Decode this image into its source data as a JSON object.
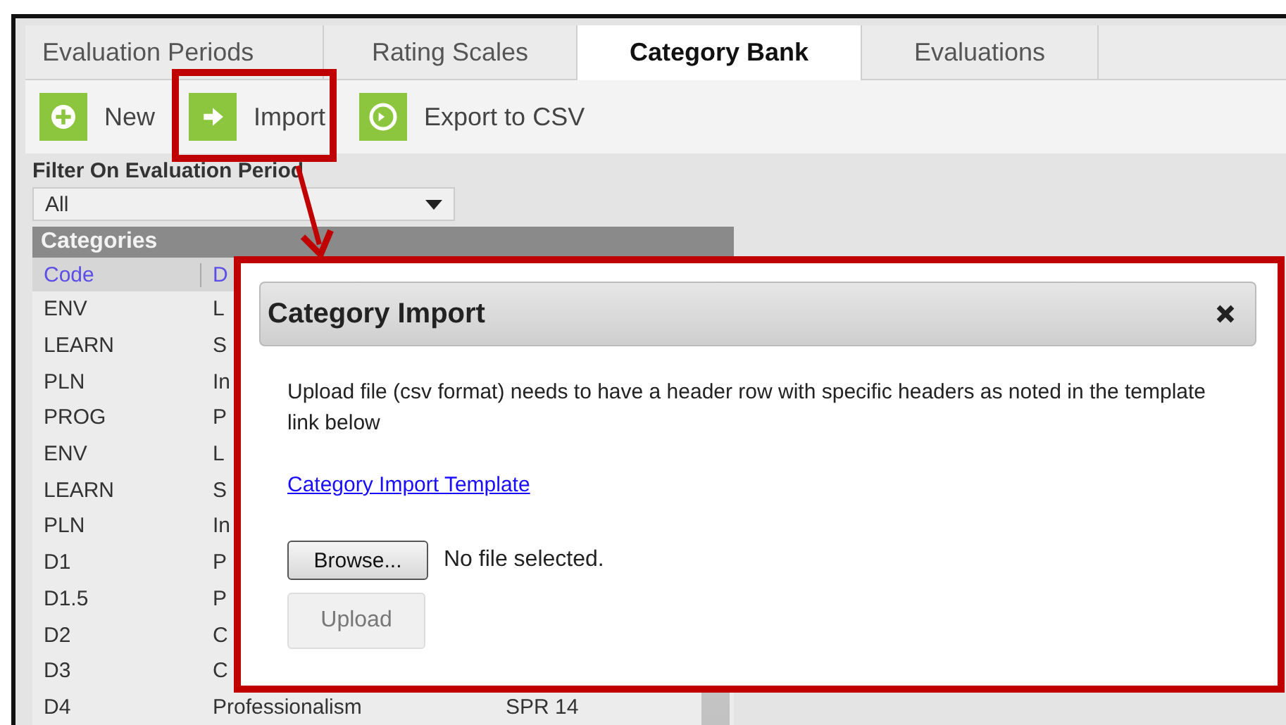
{
  "tabs": [
    {
      "label": "Evaluation Periods",
      "selected": false
    },
    {
      "label": "Rating Scales",
      "selected": false
    },
    {
      "label": "Category Bank",
      "selected": true
    },
    {
      "label": "Evaluations",
      "selected": false
    }
  ],
  "toolbar": [
    {
      "label": "New",
      "kind": "plus",
      "highlighted": false
    },
    {
      "label": "Import",
      "kind": "arrow",
      "highlighted": true
    },
    {
      "label": "Export to CSV",
      "kind": "circle",
      "highlighted": false
    }
  ],
  "filter": {
    "label": "Filter On Evaluation Period",
    "value": "All"
  },
  "categories": {
    "title": "Categories",
    "columns": [
      "Code",
      "D"
    ],
    "rows": [
      {
        "code": "ENV",
        "column_2": "L"
      },
      {
        "code": "LEARN",
        "column_2": "S"
      },
      {
        "code": "PLN",
        "column_2": "In"
      },
      {
        "code": "PROG",
        "column_2": "P"
      },
      {
        "code": "ENV",
        "column_2": "L"
      },
      {
        "code": "LEARN",
        "column_2": "S"
      },
      {
        "code": "PLN",
        "column_2": "In"
      },
      {
        "code": "D1",
        "column_2": "P"
      },
      {
        "code": "D1.5",
        "column_2": "P"
      },
      {
        "code": "D2",
        "column_2": "C"
      },
      {
        "code": "D3",
        "column_2": "C"
      },
      {
        "code": "D4",
        "column_2": "Professionalism",
        "column_3": "SPR 14"
      }
    ]
  },
  "dialog": {
    "title": "Category Import",
    "message": "Upload file (csv format) needs to have a header row with specific headers as noted in the template link below",
    "link": "Category Import Template",
    "browse_button": "Browse...",
    "file_status": "No file selected.",
    "upload_button": {
      "label": "Upload",
      "disabled": true
    }
  }
}
